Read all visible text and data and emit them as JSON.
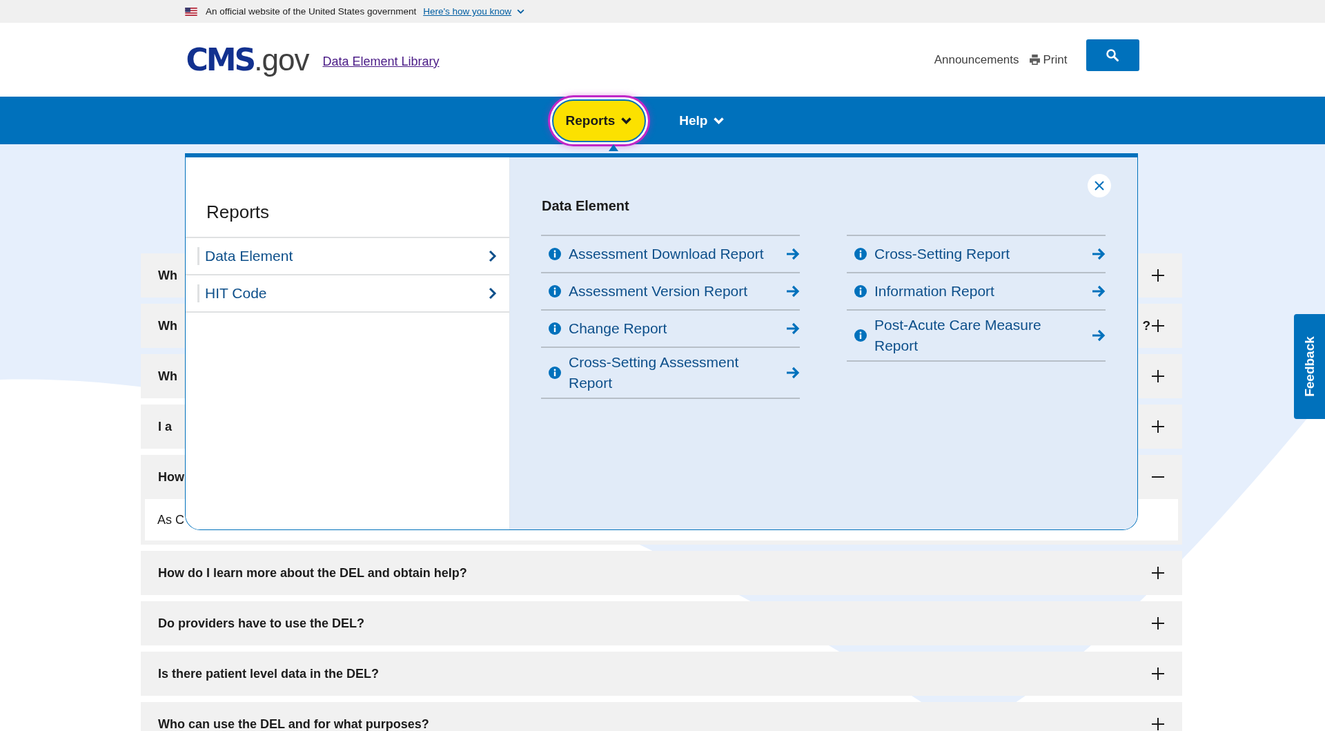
{
  "banner": {
    "text": "An official website of the United States government",
    "link": "Here's how you know"
  },
  "header": {
    "logo_main": "CMS",
    "logo_suffix": ".gov",
    "site_link": "Data Element Library",
    "links": [
      {
        "label": "Announcements",
        "kind": "text"
      },
      {
        "label": "Print",
        "kind": "print"
      }
    ]
  },
  "nav": [
    {
      "label": "Reports",
      "selected": true
    },
    {
      "label": "Help",
      "selected": false
    }
  ],
  "mega_menu": {
    "title": "Reports",
    "categories": [
      "Data Element",
      "HIT Code"
    ],
    "section_title": "Data Element",
    "columns": [
      [
        "Assessment Download Report",
        "Assessment Version Report",
        "Change Report",
        "Cross-Setting Assessment Report"
      ],
      [
        "Cross-Setting Report",
        "Information Report",
        "Post-Acute Care Measure Report"
      ]
    ]
  },
  "faq": [
    {
      "title": "Wh",
      "expanded": false
    },
    {
      "title": "Wh",
      "tail": "?",
      "expanded": false
    },
    {
      "title": "Wh",
      "expanded": false
    },
    {
      "title": "I a",
      "expanded": false
    },
    {
      "title": "How",
      "expanded": true,
      "answer": "As C"
    },
    {
      "title": "How do I learn more about the DEL and obtain help?",
      "expanded": false
    },
    {
      "title": "Do providers have to use the DEL?",
      "expanded": false
    },
    {
      "title": "Is there patient level data in the DEL?",
      "expanded": false
    },
    {
      "title": "Who can use the DEL and for what purposes?",
      "expanded": false
    }
  ],
  "feedback": "Feedback"
}
